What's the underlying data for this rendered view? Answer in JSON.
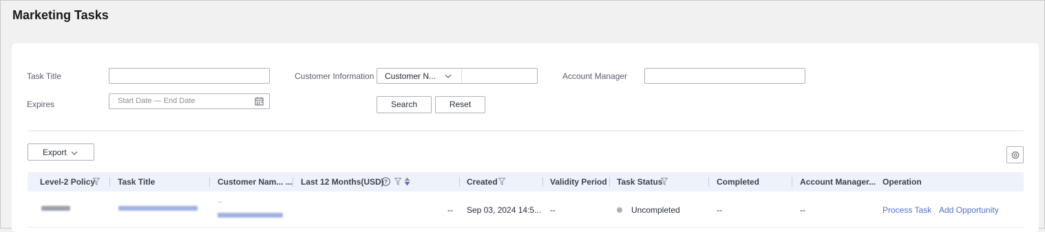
{
  "page": {
    "title": "Marketing Tasks"
  },
  "filters": {
    "task_title_label": "Task Title",
    "expires_label": "Expires",
    "date_placeholder": "Start Date — End Date",
    "customer_info_label": "Customer Information",
    "customer_select_value": "Customer N...",
    "account_manager_label": "Account Manager",
    "search_label": "Search",
    "reset_label": "Reset"
  },
  "toolbar": {
    "export_label": "Export"
  },
  "table": {
    "columns": [
      "Level-2 Policy",
      "Task Title",
      "Customer Nam... ...",
      "Last 12 Months(USD)",
      "Created",
      "Validity Period",
      "Task Status",
      "Completed",
      "Account Manager...",
      "Operation"
    ],
    "rows": [
      {
        "customer_top": "--",
        "last12": "--",
        "created": "Sep 03, 2024 14:5...",
        "validity": "--",
        "status": "Uncompleted",
        "completed": "--",
        "account_manager": "--",
        "actions": [
          "Process Task",
          "Add Opportunity"
        ]
      }
    ]
  },
  "colors": {
    "link": "#526ecc",
    "header_bg": "#eef3fb",
    "sort_active": "#526ecc",
    "status_dot": "#adb0b8"
  }
}
